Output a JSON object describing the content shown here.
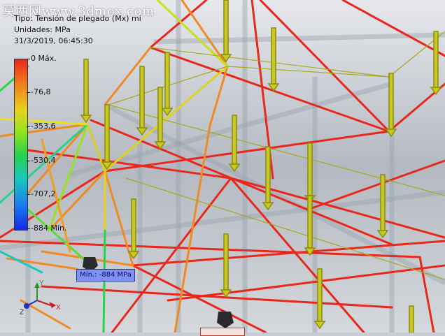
{
  "watermark": "莫西网www.3dmox.com",
  "header": {
    "type_line": "Tipo: Tensión de plegado (Mx) mi",
    "units_line": "Unidades: MPa",
    "timestamp": "31/3/2019, 06:45:30"
  },
  "legend": {
    "labels": [
      "0 Máx.",
      "-76,8",
      "-353,6",
      "-530,4",
      "-707,2",
      "-884 Mín."
    ],
    "colors": [
      "#e8281c",
      "#f07a1e",
      "#e8d21e",
      "#28d24a",
      "#18c8c0",
      "#1a7af0",
      "#1428e0"
    ]
  },
  "callout": {
    "min_label": "Mín.: -884 MPa"
  },
  "triad": {
    "x": "X",
    "y": "Y",
    "z": "Z"
  }
}
